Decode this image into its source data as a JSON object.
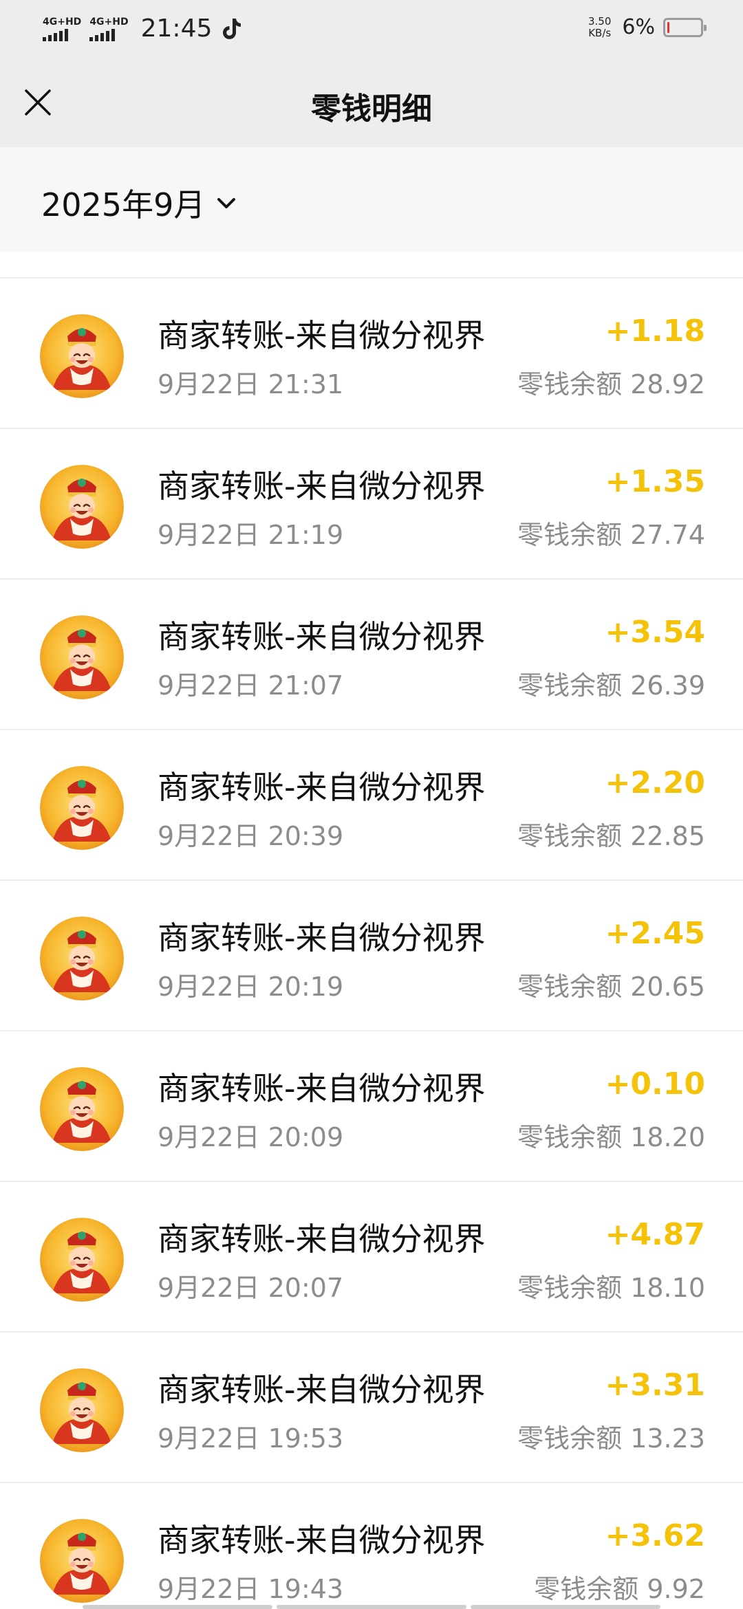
{
  "status_bar": {
    "signal1": "4G+HD",
    "signal2": "4G+HD",
    "time": "21:45",
    "net_speed_value": "3.50",
    "net_speed_unit": "KB/s",
    "battery": "6%",
    "battery_level": 0.06
  },
  "nav": {
    "title": "零钱明细",
    "close_icon": "close-icon"
  },
  "filter": {
    "month": "2025年9月",
    "icon": "chevron-down-icon"
  },
  "colors": {
    "amount": "#f5c20a",
    "secondary_text": "#8c8c8c",
    "header_bg": "#ededed"
  },
  "transactions": [
    {
      "title": "商家转账-来自微分视界",
      "time": "9月22日 21:31",
      "amount": "+1.18",
      "balance": "零钱余额 28.92"
    },
    {
      "title": "商家转账-来自微分视界",
      "time": "9月22日 21:19",
      "amount": "+1.35",
      "balance": "零钱余额 27.74"
    },
    {
      "title": "商家转账-来自微分视界",
      "time": "9月22日 21:07",
      "amount": "+3.54",
      "balance": "零钱余额 26.39"
    },
    {
      "title": "商家转账-来自微分视界",
      "time": "9月22日 20:39",
      "amount": "+2.20",
      "balance": "零钱余额 22.85"
    },
    {
      "title": "商家转账-来自微分视界",
      "time": "9月22日 20:19",
      "amount": "+2.45",
      "balance": "零钱余额 20.65"
    },
    {
      "title": "商家转账-来自微分视界",
      "time": "9月22日 20:09",
      "amount": "+0.10",
      "balance": "零钱余额 18.20"
    },
    {
      "title": "商家转账-来自微分视界",
      "time": "9月22日 20:07",
      "amount": "+4.87",
      "balance": "零钱余额 18.10"
    },
    {
      "title": "商家转账-来自微分视界",
      "time": "9月22日 19:53",
      "amount": "+3.31",
      "balance": "零钱余额 13.23"
    },
    {
      "title": "商家转账-来自微分视界",
      "time": "9月22日 19:43",
      "amount": "+3.62",
      "balance": "零钱余额 9.92"
    }
  ]
}
